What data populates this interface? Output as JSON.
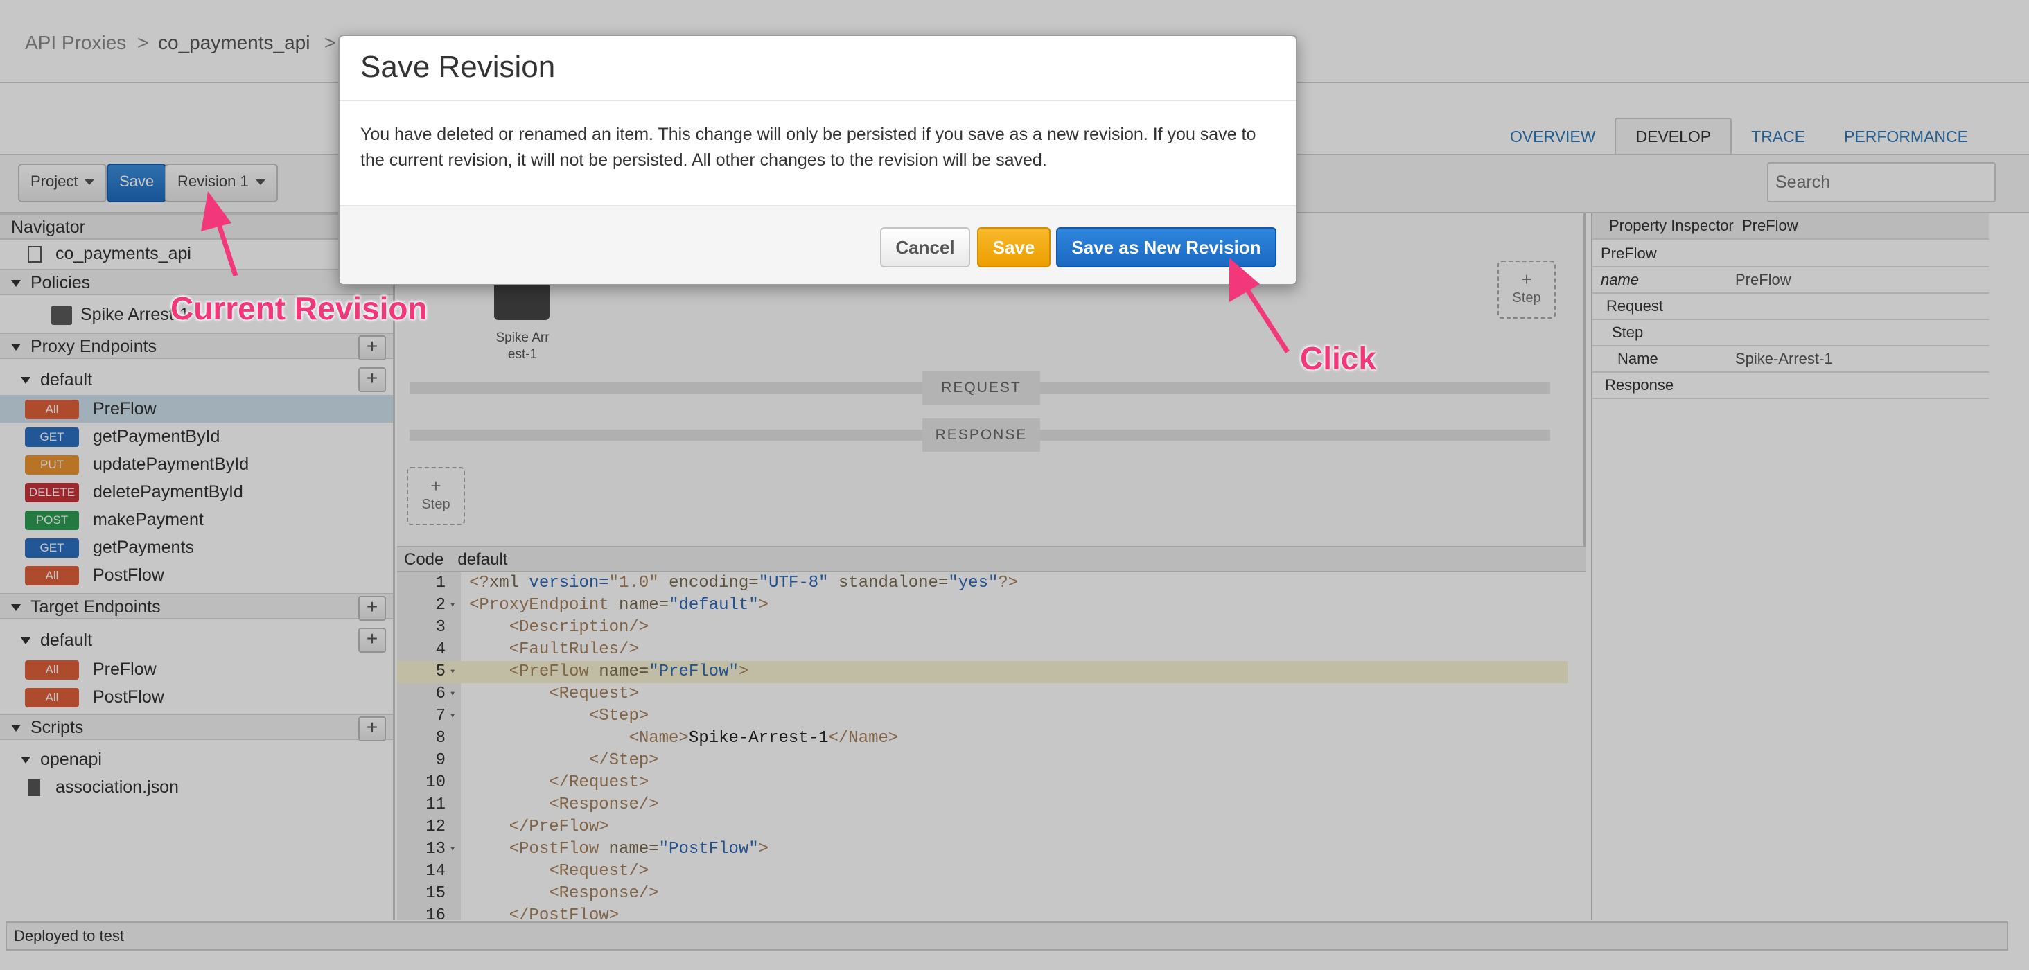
{
  "breadcrumb": {
    "root": "API Proxies",
    "sep": ">",
    "proxy": "co_payments_api"
  },
  "tabs": [
    "OVERVIEW",
    "DEVELOP",
    "TRACE",
    "PERFORMANCE"
  ],
  "active_tab": "DEVELOP",
  "toolbar": {
    "project": "Project",
    "save": "Save",
    "revision": "Revision 1",
    "search_placeholder": "Search"
  },
  "navigator": {
    "title": "Navigator",
    "proxy_name": "co_payments_api",
    "policies_label": "Policies",
    "policy_item": "Spike Arrest-1",
    "proxy_endpoints_label": "Proxy Endpoints",
    "proxy_default": "default",
    "proxy_flows": [
      {
        "verb": "All",
        "name": "PreFlow"
      },
      {
        "verb": "GET",
        "name": "getPaymentById"
      },
      {
        "verb": "PUT",
        "name": "updatePaymentById"
      },
      {
        "verb": "DELETE",
        "name": "deletePaymentById"
      },
      {
        "verb": "POST",
        "name": "makePayment"
      },
      {
        "verb": "GET",
        "name": "getPayments"
      },
      {
        "verb": "All",
        "name": "PostFlow"
      }
    ],
    "target_endpoints_label": "Target Endpoints",
    "target_default": "default",
    "target_flows": [
      {
        "verb": "All",
        "name": "PreFlow"
      },
      {
        "verb": "All",
        "name": "PostFlow"
      }
    ],
    "scripts_label": "Scripts",
    "scripts_folder": "openapi",
    "scripts_file": "association.json"
  },
  "flow": {
    "step_label": "Step",
    "plus": "+",
    "policy_caption_1": "Spike Arr",
    "policy_caption_2": "est-1",
    "request_label": "REQUEST",
    "response_label": "RESPONSE"
  },
  "code": {
    "label": "Code",
    "file": "default",
    "lines": [
      {
        "n": "1",
        "fold": ""
      },
      {
        "n": "2",
        "fold": "▾"
      },
      {
        "n": "3",
        "fold": ""
      },
      {
        "n": "4",
        "fold": ""
      },
      {
        "n": "5",
        "fold": "▾"
      },
      {
        "n": "6",
        "fold": "▾"
      },
      {
        "n": "7",
        "fold": "▾"
      },
      {
        "n": "8",
        "fold": ""
      },
      {
        "n": "9",
        "fold": ""
      },
      {
        "n": "10",
        "fold": ""
      },
      {
        "n": "11",
        "fold": ""
      },
      {
        "n": "12",
        "fold": ""
      },
      {
        "n": "13",
        "fold": "▾"
      },
      {
        "n": "14",
        "fold": ""
      },
      {
        "n": "15",
        "fold": ""
      },
      {
        "n": "16",
        "fold": ""
      }
    ],
    "l1": [
      "<?",
      "xml",
      " version=",
      "\"1.0\"",
      " encoding=",
      "\"UTF-8\"",
      " standalone=",
      "\"yes\"",
      "?>"
    ],
    "l2": [
      "<ProxyEndpoint",
      " name=",
      "\"default\"",
      ">"
    ],
    "l3": "<Description/>",
    "l4": "<FaultRules/>",
    "l5": [
      "<PreFlow",
      " name=",
      "\"PreFlow\"",
      ">"
    ],
    "l6": "<Request>",
    "l7": "<Step>",
    "l8": [
      "<Name>",
      "Spike-Arrest-1",
      "</Name>"
    ],
    "l9": "</Step>",
    "l10": "</Request>",
    "l11": "<Response/>",
    "l12": "</PreFlow>",
    "l13": [
      "<PostFlow",
      " name=",
      "\"PostFlow\"",
      ">"
    ],
    "l14": "<Request/>",
    "l15": "<Response/>",
    "l16": "</PostFlow>"
  },
  "inspector": {
    "title": "Property Inspector",
    "subject": "PreFlow",
    "section": "PreFlow",
    "name_key": "name",
    "name_value": "PreFlow",
    "request": "Request",
    "step": "Step",
    "step_name_key": "Name",
    "step_name_value": "Spike-Arrest-1",
    "response": "Response"
  },
  "status": "Deployed to test",
  "modal": {
    "title": "Save Revision",
    "body": "You have deleted or renamed an item. This change will only be persisted if you save as a new revision. If you save to the current revision, it will not be persisted. All other changes to the revision will be saved.",
    "cancel": "Cancel",
    "save": "Save",
    "save_new": "Save as New Revision"
  },
  "annotations": {
    "current_revision": "Current Revision",
    "click": "Click"
  },
  "colors": {
    "accent": "#1f6cc0",
    "save_orange": "#f0a500",
    "annotation": "#f2387a"
  }
}
